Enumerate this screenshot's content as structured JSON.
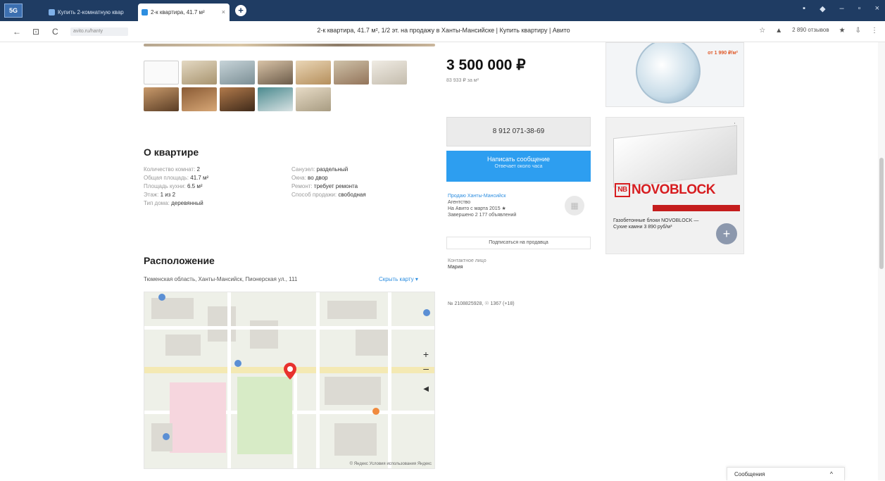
{
  "browser": {
    "logo": "5G",
    "tabs": [
      {
        "label": "Купить 2-комнатную квар"
      },
      {
        "label": "2-к квартира, 41.7 м²"
      }
    ],
    "url_chip": "avito.ru/hanty",
    "page_title": "2-к квартира, 41.7 м², 1/2 эт. на продажу в Ханты-Мансийске | Купить квартиру | Авито",
    "tab_close": "×",
    "new_tab": "+",
    "extension_label": "2 890 отзывов",
    "icons": [
      "back-icon",
      "forward-icon",
      "reload-icon",
      "lock-icon",
      "star-icon",
      "download-icon",
      "menu-icon"
    ]
  },
  "listing": {
    "price": "3 500 000 ₽",
    "price_per_meter": "83 933 ₽ за м²",
    "about_title": "О квартире",
    "params": [
      {
        "key": "Количество комнат:",
        "value": "2"
      },
      {
        "key": "Санузел:",
        "value": "раздельный"
      },
      {
        "key": "Общая площадь:",
        "value": "41.7 м²"
      },
      {
        "key": "Окна:",
        "value": "во двор"
      },
      {
        "key": "Площадь кухни:",
        "value": "6.5 м²"
      },
      {
        "key": "Ремонт:",
        "value": "требует ремонта"
      },
      {
        "key": "Этаж:",
        "value": "1 из 2"
      },
      {
        "key": "Способ продажи:",
        "value": "свободная"
      },
      {
        "key": "Тип дома:",
        "value": "деревянный"
      },
      {
        "key": "",
        "value": ""
      }
    ],
    "location_title": "Расположение",
    "address": "Тюменская область, Ханты-Мансийск, Пионерская ул., 111",
    "map_link": "Скрыть карту ▾",
    "map_footer": "© Яндекс  Условия использования  Яндекс",
    "ad_number": "№ 2108825928, ☉ 1367 (+18)"
  },
  "contact": {
    "phone": "8 912 071-38-69",
    "message_button": "Написать сообщение",
    "message_sub": "Отвечает около часа",
    "seller_name": "Продаю Ханты-Мансийск",
    "seller_type": "Агентство",
    "seller_since": "На Авито с марта 2015 ★",
    "seller_ads": "Завершено 2 177 объявлений",
    "subscribe": "Подписаться на продавца",
    "contact_person_label": "Контактное лицо",
    "contact_person": "Мария"
  },
  "ads": {
    "ad1_tag": "от 1 990 ₽/м²",
    "ad2_brand": "NOVOBLOCK",
    "ad2_logo": "NB",
    "ad2_desc": "Газобетонные блоки NOVOBLOCK — Сухие камни 3 890 руб/м³",
    "ad2_more": "⋮",
    "ad2_plus": "+"
  },
  "messages_panel": {
    "label": "Сообщения",
    "chevron": "^"
  }
}
